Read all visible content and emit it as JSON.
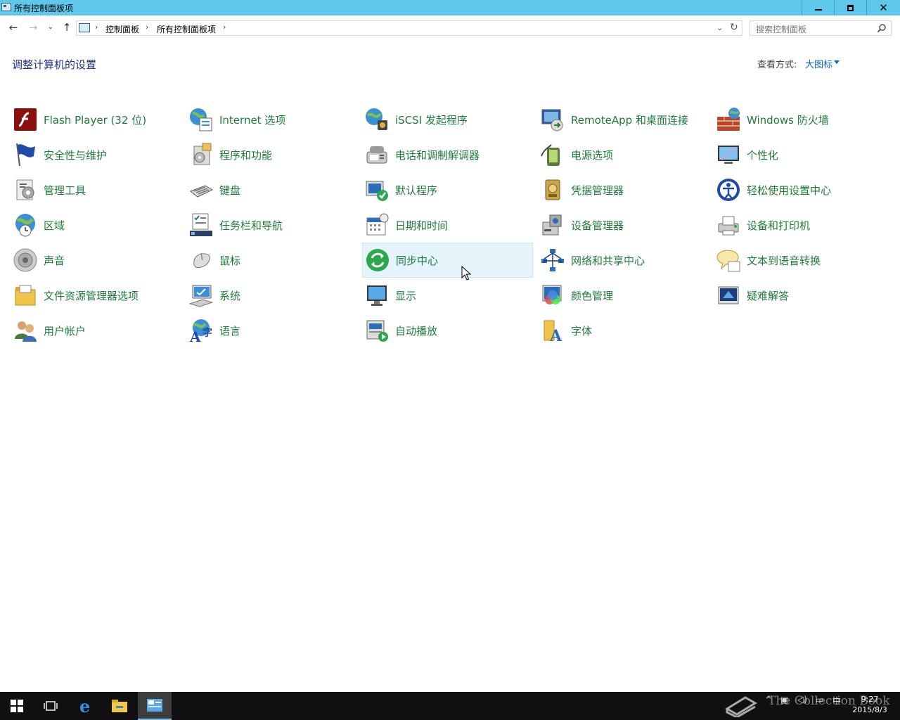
{
  "window": {
    "title": "所有控制面板项"
  },
  "titlebar_buttons": {
    "minimize": "minimize-button",
    "maximize": "restore-button",
    "close": "✕"
  },
  "address": {
    "crumbs": [
      "控制面板",
      "所有控制面板项"
    ],
    "separator": "›"
  },
  "search": {
    "placeholder": "搜索控制面板"
  },
  "heading": "调整计算机的设置",
  "view_by": {
    "label": "查看方式:",
    "value": "大图标"
  },
  "items": [
    {
      "label": "Flash Player (32 位)",
      "icon": "flash-icon"
    },
    {
      "label": "Internet 选项",
      "icon": "internet-options-icon"
    },
    {
      "label": "iSCSI 发起程序",
      "icon": "iscsi-icon"
    },
    {
      "label": "RemoteApp 和桌面连接",
      "icon": "remoteapp-icon"
    },
    {
      "label": "Windows 防火墙",
      "icon": "firewall-icon"
    },
    {
      "label": "安全性与维护",
      "icon": "security-flag-icon"
    },
    {
      "label": "程序和功能",
      "icon": "programs-icon"
    },
    {
      "label": "电话和调制解调器",
      "icon": "phone-modem-icon"
    },
    {
      "label": "电源选项",
      "icon": "power-icon"
    },
    {
      "label": "个性化",
      "icon": "personalization-icon"
    },
    {
      "label": "管理工具",
      "icon": "admin-tools-icon"
    },
    {
      "label": "键盘",
      "icon": "keyboard-icon"
    },
    {
      "label": "默认程序",
      "icon": "default-programs-icon"
    },
    {
      "label": "凭据管理器",
      "icon": "credential-icon"
    },
    {
      "label": "轻松使用设置中心",
      "icon": "ease-of-access-icon"
    },
    {
      "label": "区域",
      "icon": "region-icon"
    },
    {
      "label": "任务栏和导航",
      "icon": "taskbar-icon"
    },
    {
      "label": "日期和时间",
      "icon": "datetime-icon"
    },
    {
      "label": "设备管理器",
      "icon": "device-manager-icon"
    },
    {
      "label": "设备和打印机",
      "icon": "printer-icon"
    },
    {
      "label": "声音",
      "icon": "sound-icon"
    },
    {
      "label": "鼠标",
      "icon": "mouse-icon"
    },
    {
      "label": "同步中心",
      "icon": "sync-icon"
    },
    {
      "label": "网络和共享中心",
      "icon": "network-icon"
    },
    {
      "label": "文本到语音转换",
      "icon": "speech-icon"
    },
    {
      "label": "文件资源管理器选项",
      "icon": "folder-options-icon"
    },
    {
      "label": "系统",
      "icon": "system-icon"
    },
    {
      "label": "显示",
      "icon": "display-icon"
    },
    {
      "label": "颜色管理",
      "icon": "color-icon"
    },
    {
      "label": "疑难解答",
      "icon": "troubleshoot-icon"
    },
    {
      "label": "用户帐户",
      "icon": "user-accounts-icon"
    },
    {
      "label": "语言",
      "icon": "language-icon"
    },
    {
      "label": "自动播放",
      "icon": "autoplay-icon"
    },
    {
      "label": "字体",
      "icon": "fonts-icon"
    }
  ],
  "hovered_item": "同步中心",
  "taskbar": {
    "apps": [
      "start-icon",
      "task-view-icon",
      "edge-icon",
      "file-explorer-icon",
      "control-panel-icon"
    ],
    "watermark": "The Collection Book",
    "clock_time": "9:27",
    "clock_date": "2015/8/3",
    "ime": "中"
  },
  "colors": {
    "titlebar": "#5fc8ea",
    "item_text": "#1e7a3c",
    "heading": "#1e3287",
    "link": "#0066cc",
    "taskbar": "#101010"
  }
}
